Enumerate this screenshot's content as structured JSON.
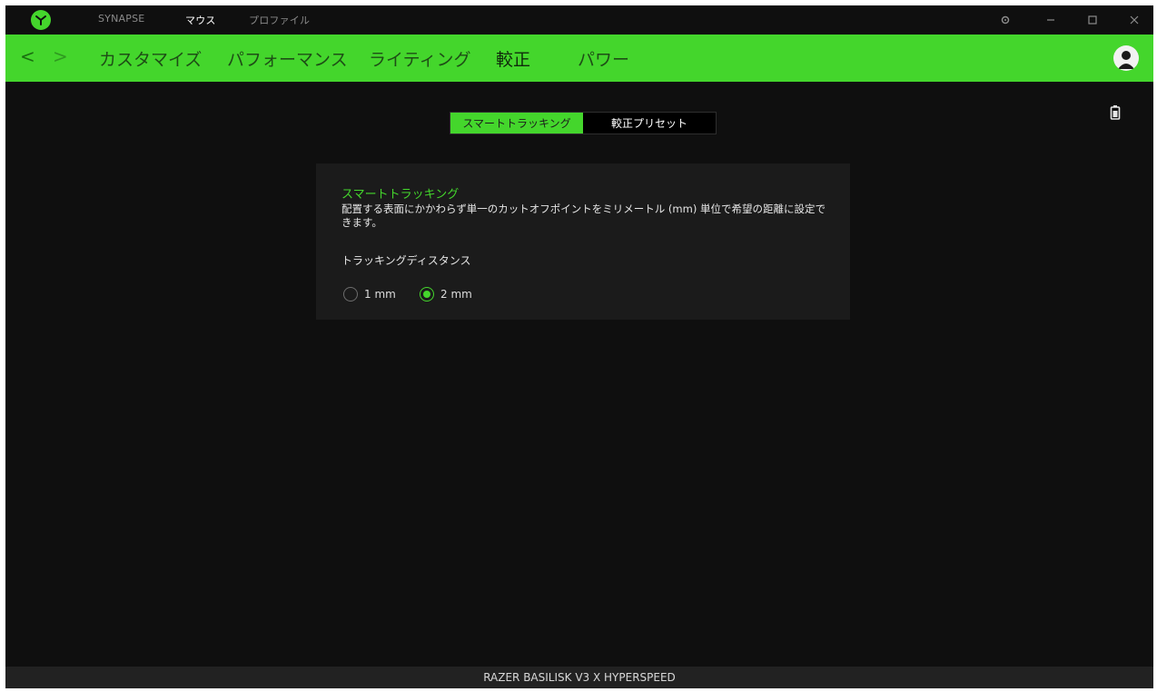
{
  "titlebar": {
    "tabs": [
      "SYNAPSE",
      "マウス",
      "プロファイル"
    ],
    "active_tab_index": 1,
    "window_controls": [
      "settings-gear-icon",
      "minimize-icon",
      "maximize-icon",
      "close-icon"
    ]
  },
  "navbar": {
    "back_icon": "<",
    "forward_icon": ">",
    "tabs": [
      "カスタマイズ",
      "パフォーマンス",
      "ライティング",
      "較正",
      "パワー"
    ],
    "active_tab_index": 3
  },
  "segmented": {
    "options": [
      "スマートトラッキング",
      "較正プリセット"
    ],
    "active_index": 0
  },
  "card": {
    "title": "スマートトラッキング",
    "description": "配置する表面にかかわらず単一のカットオフポイントをミリメートル (mm) 単位で希望の距離に設定できます。",
    "distance_label": "トラッキングディスタンス",
    "options": [
      {
        "label": "1 mm",
        "checked": false
      },
      {
        "label": "2 mm",
        "checked": true
      }
    ]
  },
  "status": {
    "device_name": "RAZER BASILISK V3 X HYPERSPEED"
  },
  "colors": {
    "accent": "#44d62c",
    "background": "#0f0f0f",
    "card": "#1b1b1b"
  }
}
